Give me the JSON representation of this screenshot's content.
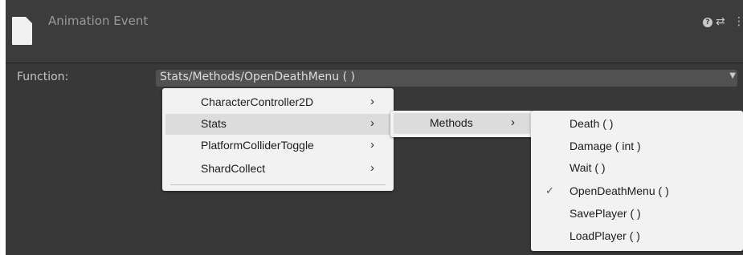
{
  "window": {
    "title": "Animation Event",
    "icons": [
      "document-icon",
      "help-icon",
      "preset-icon",
      "menu-icon"
    ]
  },
  "function_field": {
    "label": "Function:",
    "value": "Stats/Methods/OpenDeathMenu ( )"
  },
  "menu_level1": {
    "items": [
      {
        "label": "CharacterController2D",
        "has_submenu": true,
        "highlighted": false
      },
      {
        "label": "Stats",
        "has_submenu": true,
        "highlighted": true
      },
      {
        "label": "PlatformColliderToggle",
        "has_submenu": true,
        "highlighted": false
      },
      {
        "label": "ShardCollect",
        "has_submenu": true,
        "highlighted": false
      }
    ]
  },
  "menu_level2": {
    "items": [
      {
        "label": "Methods",
        "has_submenu": true,
        "highlighted": true
      }
    ]
  },
  "menu_level3": {
    "items": [
      {
        "label": "Death ( )",
        "checked": false
      },
      {
        "label": "Damage ( int )",
        "checked": false
      },
      {
        "label": "Wait ( )",
        "checked": false
      },
      {
        "label": "OpenDeathMenu ( )",
        "checked": true
      },
      {
        "label": "SavePlayer ( )",
        "checked": false
      },
      {
        "label": "LoadPlayer ( )",
        "checked": false
      }
    ]
  },
  "colors": {
    "panel_bg": "#383838",
    "header_bg": "#3c3c3c",
    "field_bg": "#515151",
    "menu_bg": "#f2f2f2",
    "highlight": "#dcdcdc"
  }
}
